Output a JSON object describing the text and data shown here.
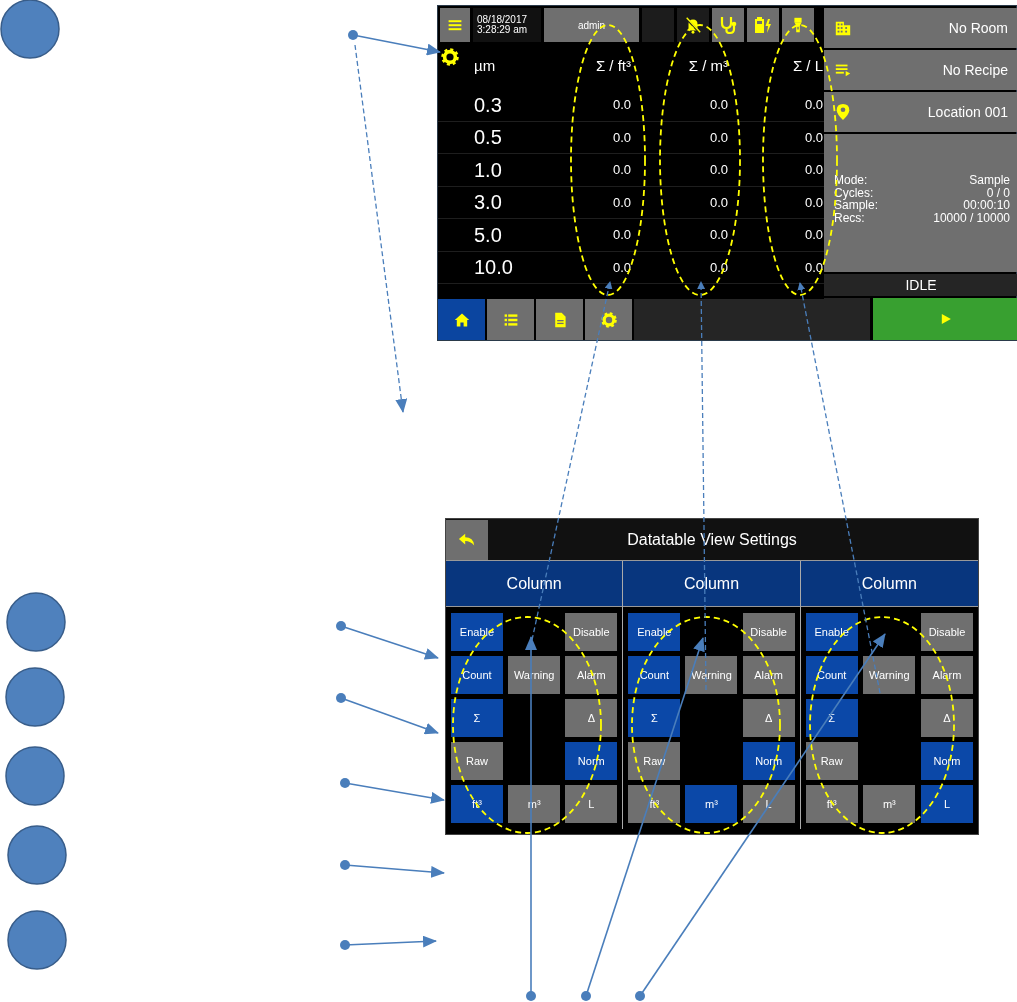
{
  "main_screen": {
    "top_bar": {
      "date": "08/18/2017",
      "time": "3:28:29 am",
      "user": "admin"
    },
    "table": {
      "columns": [
        "µm",
        "Σ / ft³",
        "Σ / m³",
        "Σ / L"
      ],
      "rows": [
        [
          "0.3",
          "0.0",
          "0.0",
          "0.0"
        ],
        [
          "0.5",
          "0.0",
          "0.0",
          "0.0"
        ],
        [
          "1.0",
          "0.0",
          "0.0",
          "0.0"
        ],
        [
          "3.0",
          "0.0",
          "0.0",
          "0.0"
        ],
        [
          "5.0",
          "0.0",
          "0.0",
          "0.0"
        ],
        [
          "10.0",
          "0.0",
          "0.0",
          "0.0"
        ]
      ]
    },
    "side_panel": {
      "buttons": [
        {
          "kind": "room",
          "label": "No Room"
        },
        {
          "kind": "recipe",
          "label": "No Recipe"
        },
        {
          "kind": "location",
          "label": "Location 001"
        }
      ],
      "info": [
        {
          "label": "Mode:",
          "value": "Sample"
        },
        {
          "label": "Cycles:",
          "value": "0 / 0"
        },
        {
          "label": "Sample:",
          "value": "00:00:10"
        },
        {
          "label": "Recs:",
          "value": "10000 / 10000"
        }
      ],
      "state": "IDLE"
    },
    "nav": [
      {
        "kind": "home",
        "selected": true
      },
      {
        "kind": "list",
        "selected": false
      },
      {
        "kind": "document",
        "selected": false
      },
      {
        "kind": "settings",
        "selected": false
      }
    ]
  },
  "settings_screen": {
    "title": "Datatable View Settings",
    "columns": [
      {
        "header": "Column",
        "rows": [
          [
            {
              "label": "Enable",
              "selected": true
            },
            null,
            {
              "label": "Disable",
              "selected": false
            }
          ],
          [
            {
              "label": "Count",
              "selected": true
            },
            {
              "label": "Warning",
              "selected": false
            },
            {
              "label": "Alarm",
              "selected": false
            }
          ],
          [
            {
              "label": "Σ",
              "selected": true
            },
            null,
            {
              "label": "Δ",
              "selected": false
            }
          ],
          [
            {
              "label": "Raw",
              "selected": false
            },
            null,
            {
              "label": "Norm",
              "selected": true
            }
          ],
          [
            {
              "label": "ft³",
              "selected": true
            },
            {
              "label": "m³",
              "selected": false
            },
            {
              "label": "L",
              "selected": false
            }
          ]
        ]
      },
      {
        "header": "Column",
        "rows": [
          [
            {
              "label": "Enable",
              "selected": true
            },
            null,
            {
              "label": "Disable",
              "selected": false
            }
          ],
          [
            {
              "label": "Count",
              "selected": true
            },
            {
              "label": "Warning",
              "selected": false
            },
            {
              "label": "Alarm",
              "selected": false
            }
          ],
          [
            {
              "label": "Σ",
              "selected": true
            },
            null,
            {
              "label": "Δ",
              "selected": false
            }
          ],
          [
            {
              "label": "Raw",
              "selected": false
            },
            null,
            {
              "label": "Norm",
              "selected": true
            }
          ],
          [
            {
              "label": "ft³",
              "selected": false
            },
            {
              "label": "m³",
              "selected": true
            },
            {
              "label": "L",
              "selected": false
            }
          ]
        ]
      },
      {
        "header": "Column",
        "rows": [
          [
            {
              "label": "Enable",
              "selected": true
            },
            null,
            {
              "label": "Disable",
              "selected": false
            }
          ],
          [
            {
              "label": "Count",
              "selected": true
            },
            {
              "label": "Warning",
              "selected": false
            },
            {
              "label": "Alarm",
              "selected": false
            }
          ],
          [
            {
              "label": "Σ",
              "selected": true
            },
            null,
            {
              "label": "Δ",
              "selected": false
            }
          ],
          [
            {
              "label": "Raw",
              "selected": false
            },
            null,
            {
              "label": "Norm",
              "selected": true
            }
          ],
          [
            {
              "label": "ft³",
              "selected": false
            },
            {
              "label": "m³",
              "selected": false
            },
            {
              "label": "L",
              "selected": true
            }
          ]
        ]
      }
    ]
  }
}
